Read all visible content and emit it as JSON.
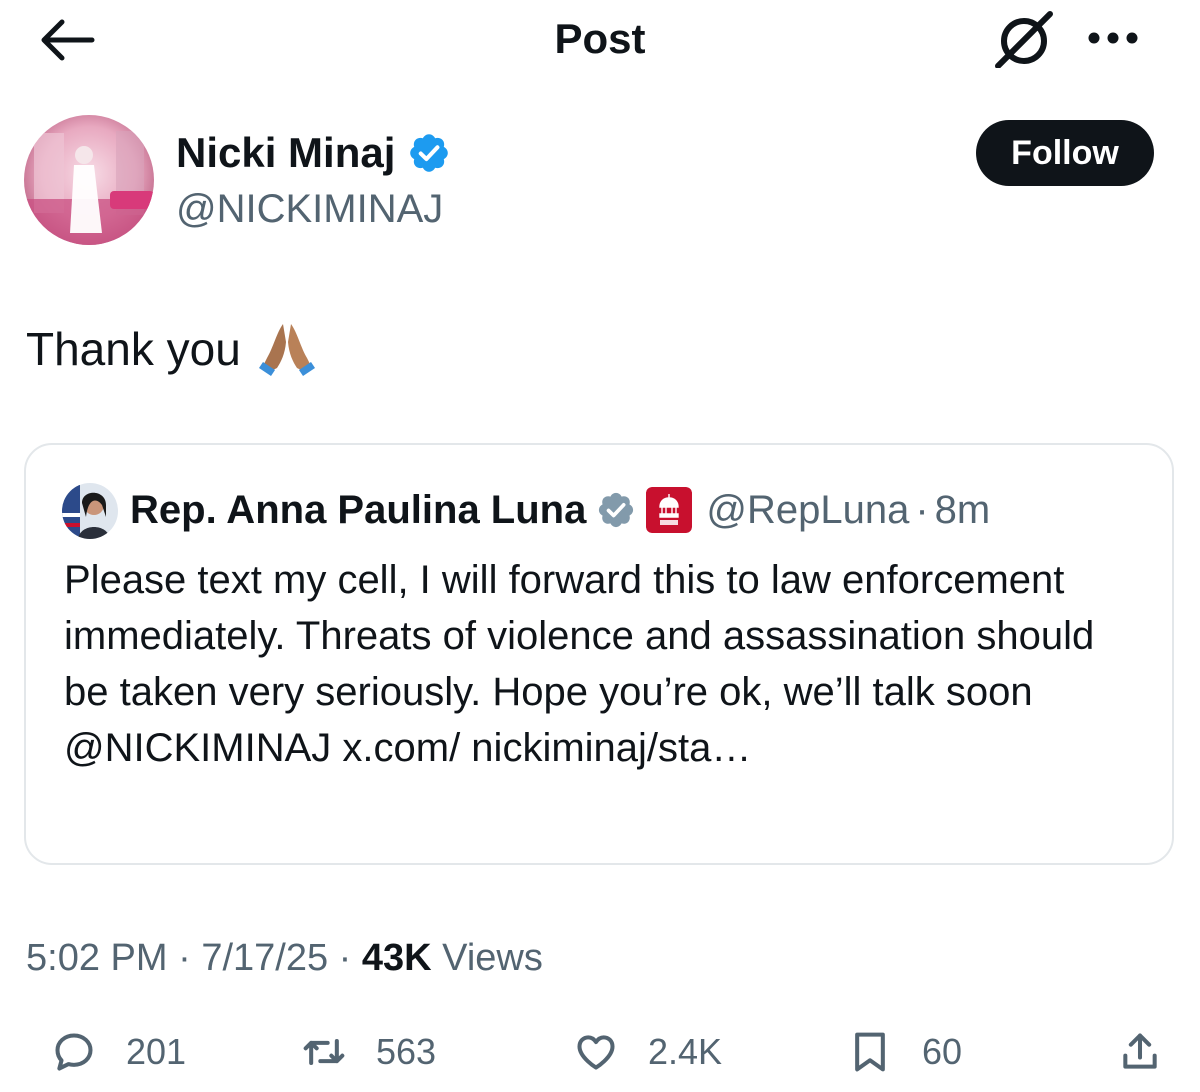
{
  "header": {
    "title": "Post"
  },
  "author": {
    "name": "Nicki Minaj",
    "handle": "@NICKIMINAJ",
    "follow_label": "Follow"
  },
  "tweet": {
    "text": "Thank you"
  },
  "quote": {
    "name": "Rep. Anna Paulina Luna",
    "handle": "@RepLuna",
    "sep": "·",
    "time": "8m",
    "text": "Please text my cell, I will forward this to law enforcement immediately. Threats of violence and assassination should be taken very seriously. Hope you’re ok, we’ll talk soon @NICKIMINAJ x.com/ nickiminaj/sta…"
  },
  "meta": {
    "time": "5:02 PM",
    "sep": "·",
    "date": "7/17/25",
    "views_count": "43K",
    "views_label": "Views"
  },
  "actions": {
    "replies": "201",
    "reposts": "563",
    "likes": "2.4K",
    "bookmarks": "60"
  },
  "colors": {
    "verified": "#1d9bf0",
    "gov_verified": "#829aab",
    "text": "#0f1419",
    "muted": "#536471",
    "badge_red": "#c8102e"
  },
  "icons": [
    "back-arrow-icon",
    "grok-icon",
    "more-icon",
    "verified-badge-icon",
    "praying-hands-emoji",
    "gov-badge-icon",
    "reply-icon",
    "repost-icon",
    "like-icon",
    "bookmark-icon",
    "share-icon"
  ]
}
